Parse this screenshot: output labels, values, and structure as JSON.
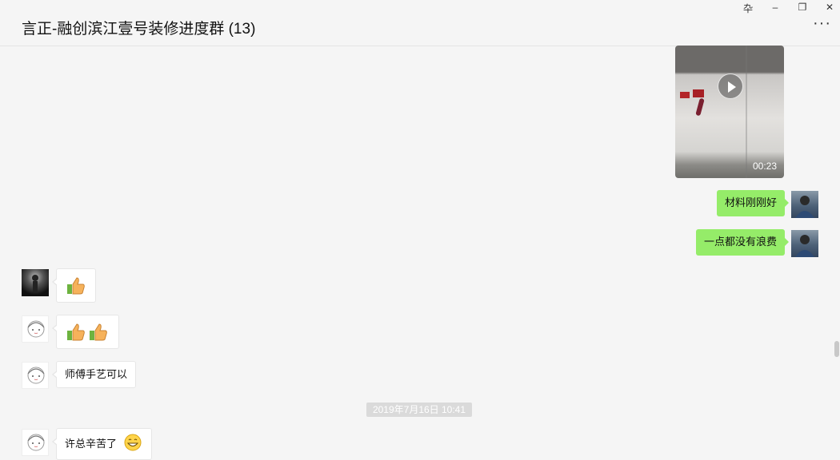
{
  "window": {
    "title": "言正-融创滨江壹号装修进度群 (13)",
    "controls": {
      "pin": "卆",
      "minimize": "–",
      "restore": "❐",
      "close": "✕"
    },
    "more": "···"
  },
  "messages": {
    "video": {
      "duration": "00:23",
      "icon": "play-icon"
    },
    "me1": {
      "text": "材料刚刚好"
    },
    "me2": {
      "text": "一点都没有浪费"
    },
    "other1": {
      "emoji": [
        "thumbs-up"
      ]
    },
    "other2": {
      "emoji": [
        "thumbs-up",
        "thumbs-up"
      ]
    },
    "other3": {
      "text": "师傅手艺可以"
    },
    "timestamp": "2019年7月16日 10:41",
    "other4": {
      "text": "许总辛苦了",
      "emoji": "grin"
    }
  },
  "colors": {
    "sent_bubble": "#95ec69",
    "background": "#f5f5f5"
  }
}
